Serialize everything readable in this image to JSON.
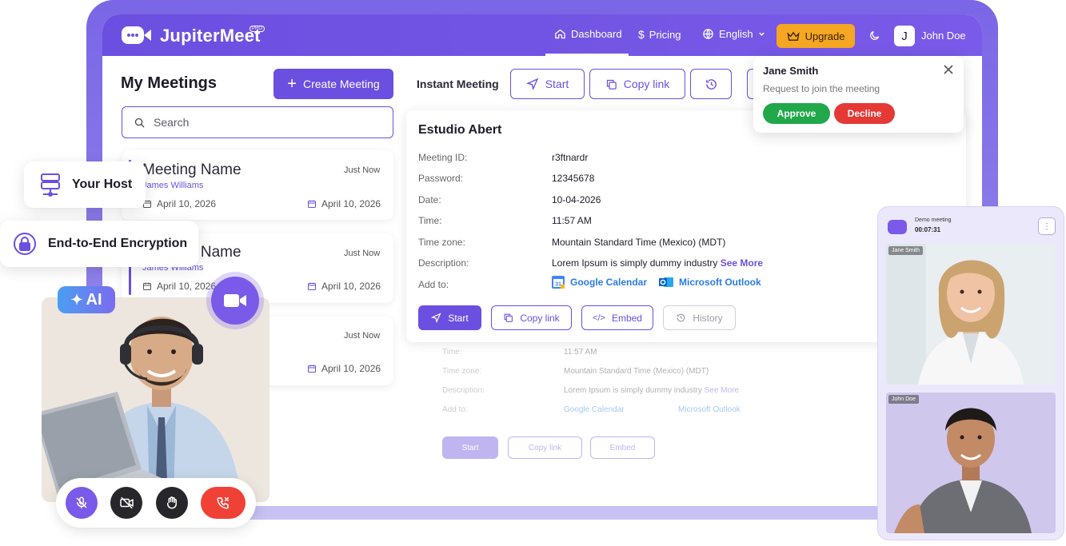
{
  "app": {
    "logo_text": "JupiterMeet",
    "logo_badge": "PRO"
  },
  "nav": {
    "dashboard": "Dashboard",
    "pricing": "Pricing",
    "language": "English",
    "upgrade": "Upgrade",
    "user_initial": "J",
    "user_name": "John Doe"
  },
  "meetings": {
    "title": "My Meetings",
    "create_label": "Create Meeting",
    "search_placeholder": "Search",
    "items": [
      {
        "name": "Meeting Name",
        "host": "James Williams",
        "when": "Just Now",
        "date_left": "April 10, 2026",
        "date_right": "April 10, 2026"
      },
      {
        "name": "Meeting Name",
        "host": "James Williams",
        "when": "Just Now",
        "date_left": "April 10, 2026",
        "date_right": "April 10, 2026"
      },
      {
        "name": "",
        "host": "",
        "when": "Just Now",
        "date_left": "",
        "date_right": "April 10, 2026"
      }
    ]
  },
  "instant": {
    "label": "Instant Meeting",
    "start": "Start",
    "copy_link": "Copy link"
  },
  "detail": {
    "title": "Estudio Abert",
    "labels": {
      "meeting_id": "Meeting ID:",
      "password": "Password:",
      "date": "Date:",
      "time": "Time:",
      "timezone": "Time zone:",
      "description": "Description:",
      "add_to": "Add to:"
    },
    "values": {
      "meeting_id": "r3ftnardr",
      "password": "12345678",
      "date": "10-04-2026",
      "time": "11:57 AM",
      "timezone": "Mountain Standard Time (Mexico) (MDT)",
      "description": "Lorem Ipsum is simply dummy industry",
      "see_more": "See More",
      "google": "Google Calendar",
      "outlook": "Microsoft Outlook"
    },
    "buttons": {
      "start": "Start",
      "copy_link": "Copy link",
      "embed": "Embed",
      "history": "History"
    }
  },
  "toast": {
    "name": "Jane Smith",
    "message": "Request to join the meeting",
    "approve": "Approve",
    "decline": "Decline"
  },
  "badges": {
    "host": "Your Host",
    "encryption": "End-to-End Encryption",
    "ai": "AI"
  },
  "call": {
    "title": "Demo meeting",
    "timer": "00:07:31",
    "participants": [
      "Jane Smith",
      "John Doe"
    ]
  },
  "colors": {
    "brand": "#6b4fe0",
    "upgrade": "#f5a623",
    "approve": "#21a84a",
    "decline": "#e53935",
    "end_call": "#ef4136"
  }
}
